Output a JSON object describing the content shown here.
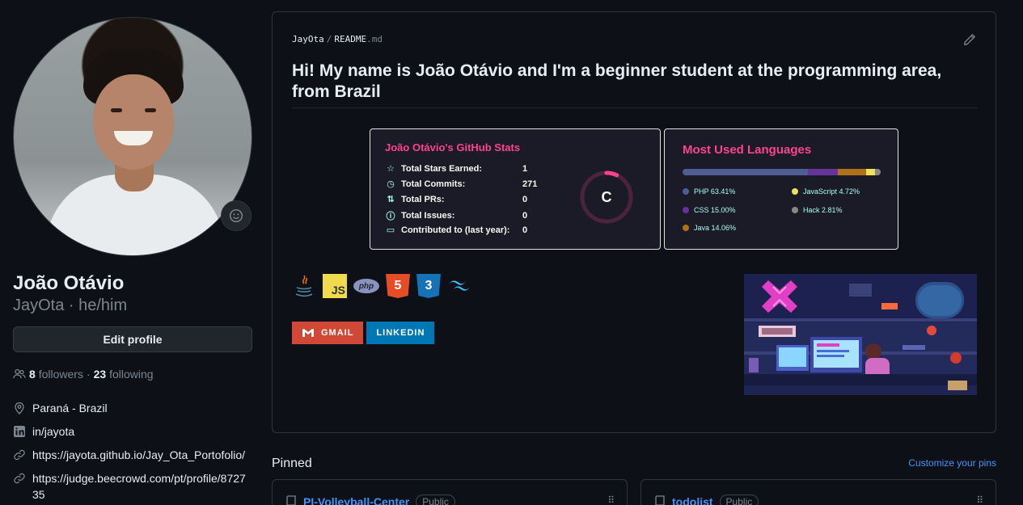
{
  "profile": {
    "full_name": "João Otávio",
    "username_line": "JayOta · he/him",
    "edit_label": "Edit profile",
    "followers_count": "8",
    "followers_label": "followers",
    "following_count": "23",
    "following_label": "following",
    "location": "Paraná - Brazil",
    "linkedin": "in/jayota",
    "website": "https://jayota.github.io/Jay_Ota_Portofolio/",
    "beecrowd": "https://judge.beecrowd.com/pt/profile/872735",
    "separator_dot": "·"
  },
  "readme": {
    "owner": "JayOta",
    "separator": "/",
    "file_name": "README",
    "file_ext": ".md",
    "title": "Hi! My name is João Otávio and I'm a beginner student at the programming area, from Brazil"
  },
  "stats_card": {
    "title": "João Otávio's GitHub Stats",
    "rows": [
      {
        "label": "Total Stars Earned:",
        "value": "1"
      },
      {
        "label": "Total Commits:",
        "value": "271"
      },
      {
        "label": "Total PRs:",
        "value": "0"
      },
      {
        "label": "Total Issues:",
        "value": "0"
      },
      {
        "label": "Contributed to (last year):",
        "value": "0"
      }
    ],
    "grade": "C",
    "grade_progress": 0.07,
    "colors": {
      "title": "#fe428e",
      "icon": "#a9fef7",
      "bg": "#1a1b27"
    }
  },
  "languages_card": {
    "title": "Most Used Languages",
    "languages": [
      {
        "name": "PHP",
        "percent": 63.41,
        "label": "PHP 63.41%",
        "color": "#4F5D95"
      },
      {
        "name": "CSS",
        "percent": 15.0,
        "label": "CSS 15.00%",
        "color": "#663399"
      },
      {
        "name": "Java",
        "percent": 14.06,
        "label": "Java 14.06%",
        "color": "#b07219"
      },
      {
        "name": "JavaScript",
        "percent": 4.72,
        "label": "JavaScript 4.72%",
        "color": "#f1e05a"
      },
      {
        "name": "Hack",
        "percent": 2.81,
        "label": "Hack 2.81%",
        "color": "#878787"
      }
    ]
  },
  "tech_icons": {
    "js": "JS",
    "php": "php",
    "html": "5",
    "css": "3"
  },
  "badges": {
    "gmail": "GMAIL",
    "linkedin": "LINKEDIN"
  },
  "pinned": {
    "title": "Pinned",
    "customize": "Customize your pins",
    "repos": [
      {
        "name": "PI-Volleyball-Center",
        "visibility": "Public"
      },
      {
        "name": "todolist",
        "visibility": "Public"
      }
    ]
  }
}
